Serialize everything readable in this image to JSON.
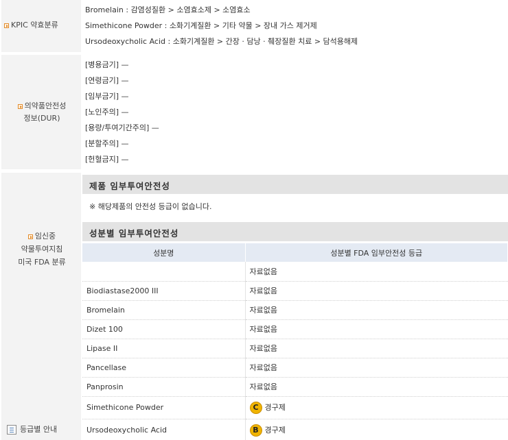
{
  "kpic": {
    "label": "KPIC 약효분류",
    "lines": [
      "Bromelain : 감염성질환 > 소염효소제 > 소염효소",
      "Simethicone Powder : 소화기계질환 > 기타 약물 > 장내 가스 제거제",
      "Ursodeoxycholic Acid : 소화기계질환 > 간장 · 담낭 · 췌장질환 치료 > 담석용해제"
    ]
  },
  "dur": {
    "label_line1": "의약품안전성",
    "label_line2": "정보(DUR)",
    "lines": [
      "[병용금기]   —",
      "[연령금기]   —",
      "[임부금기]   —",
      "[노인주의]   —",
      "[용량/투여기간주의] —",
      "[분할주의]   —",
      "[헌혈금지]   —"
    ]
  },
  "pregnancy": {
    "label_line1": "임신중",
    "label_line2": "약물투여지침",
    "label_line3": "미국 FDA 분류",
    "guide_link": "등급별 안내",
    "product_heading": "제품 임부투여안전성",
    "product_note": "※ 해당제품의 안전성 등급이 없습니다.",
    "ingredient_heading": "성분별 임부투여안전성",
    "table_headers": [
      "성분명",
      "성분별 FDA 임부안전성 등급"
    ],
    "rows": [
      {
        "name": "",
        "grade": "",
        "value": "자료없음"
      },
      {
        "name": "Biodiastase2000 III",
        "grade": "",
        "value": "자료없음"
      },
      {
        "name": "Bromelain",
        "grade": "",
        "value": "자료없음"
      },
      {
        "name": "Dizet 100",
        "grade": "",
        "value": "자료없음"
      },
      {
        "name": "Lipase II",
        "grade": "",
        "value": "자료없음"
      },
      {
        "name": "Pancellase",
        "grade": "",
        "value": "자료없음"
      },
      {
        "name": "Panprosin",
        "grade": "",
        "value": "자료없음"
      },
      {
        "name": "Simethicone Powder",
        "grade": "C",
        "value": "경구제"
      },
      {
        "name": "Ursodeoxycholic Acid",
        "grade": "B",
        "value": "경구제"
      }
    ]
  }
}
